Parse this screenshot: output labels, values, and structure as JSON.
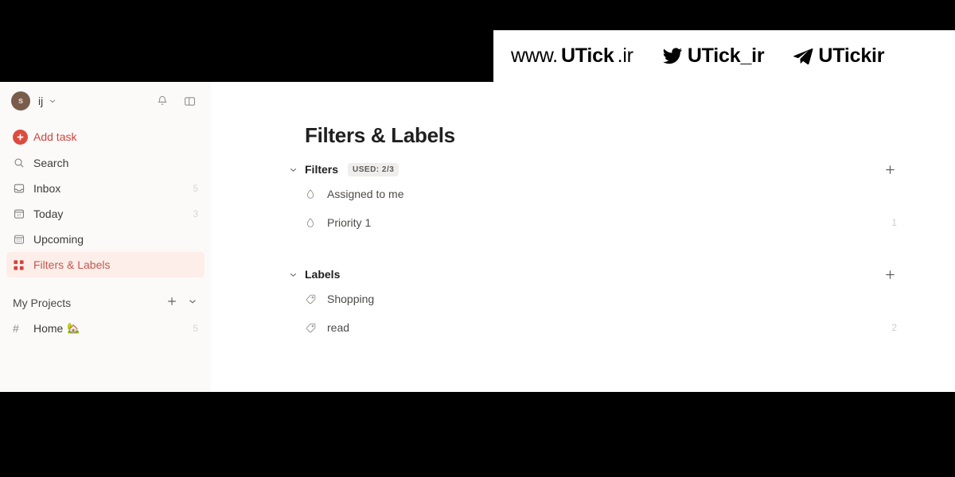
{
  "watermark": {
    "website": "www.UTick.ir",
    "website_prefix": "www.",
    "website_brand": "UTick",
    "website_suffix": ".ir",
    "twitter_handle": "UTick_ir",
    "telegram_handle": "UTickir",
    "twitter_icon": "twitter-bird-icon",
    "telegram_icon": "telegram-paper-plane-icon",
    "background": "#ffffff",
    "text_color": "#000000"
  },
  "sidebar": {
    "account": {
      "avatar_initial": "s",
      "avatar_color": "#7a5c4b",
      "user_name": "ij",
      "chevron_icon": "chevron-down-icon"
    },
    "header_actions": [
      {
        "name": "notifications",
        "icon": "bell-icon"
      },
      {
        "name": "toggle-sidebar",
        "icon": "sidebar-panel-icon"
      }
    ],
    "add_task": {
      "label": "Add task",
      "icon": "plus-circle-icon",
      "color": "#dc4c3e"
    },
    "nav_items": [
      {
        "label": "Search",
        "icon": "search-icon",
        "count": "",
        "active": false
      },
      {
        "label": "Inbox",
        "icon": "inbox-icon",
        "count": "5",
        "active": false
      },
      {
        "label": "Today",
        "icon": "calendar-today-icon",
        "count": "3",
        "active": false
      },
      {
        "label": "Upcoming",
        "icon": "calendar-upcoming-icon",
        "count": "",
        "active": false
      },
      {
        "label": "Filters & Labels",
        "icon": "grid-squares-icon",
        "count": "",
        "active": true
      }
    ],
    "projects_section": {
      "label": "My Projects",
      "add_icon": "plus-icon",
      "collapse_icon": "chevron-down-icon",
      "projects": [
        {
          "label": "Home",
          "emoji": "🏡",
          "hash": "#",
          "count": "5"
        }
      ]
    },
    "active_highlight_color": "#fdeee9",
    "accent_color": "#d1453b"
  },
  "main": {
    "page_title": "Filters & Labels",
    "sections": [
      {
        "title": "Filters",
        "badge": "USED: 2/3",
        "caret_icon": "chevron-down-icon",
        "add_icon": "plus-icon",
        "items": [
          {
            "label": "Assigned to me",
            "icon": "filter-droplet-icon",
            "count": ""
          },
          {
            "label": "Priority 1",
            "icon": "filter-droplet-icon",
            "count": "1"
          }
        ]
      },
      {
        "title": "Labels",
        "badge": "",
        "caret_icon": "chevron-down-icon",
        "add_icon": "plus-icon",
        "items": [
          {
            "label": "Shopping",
            "icon": "tag-icon",
            "count": ""
          },
          {
            "label": "read",
            "icon": "tag-icon",
            "count": "2"
          }
        ]
      }
    ]
  }
}
